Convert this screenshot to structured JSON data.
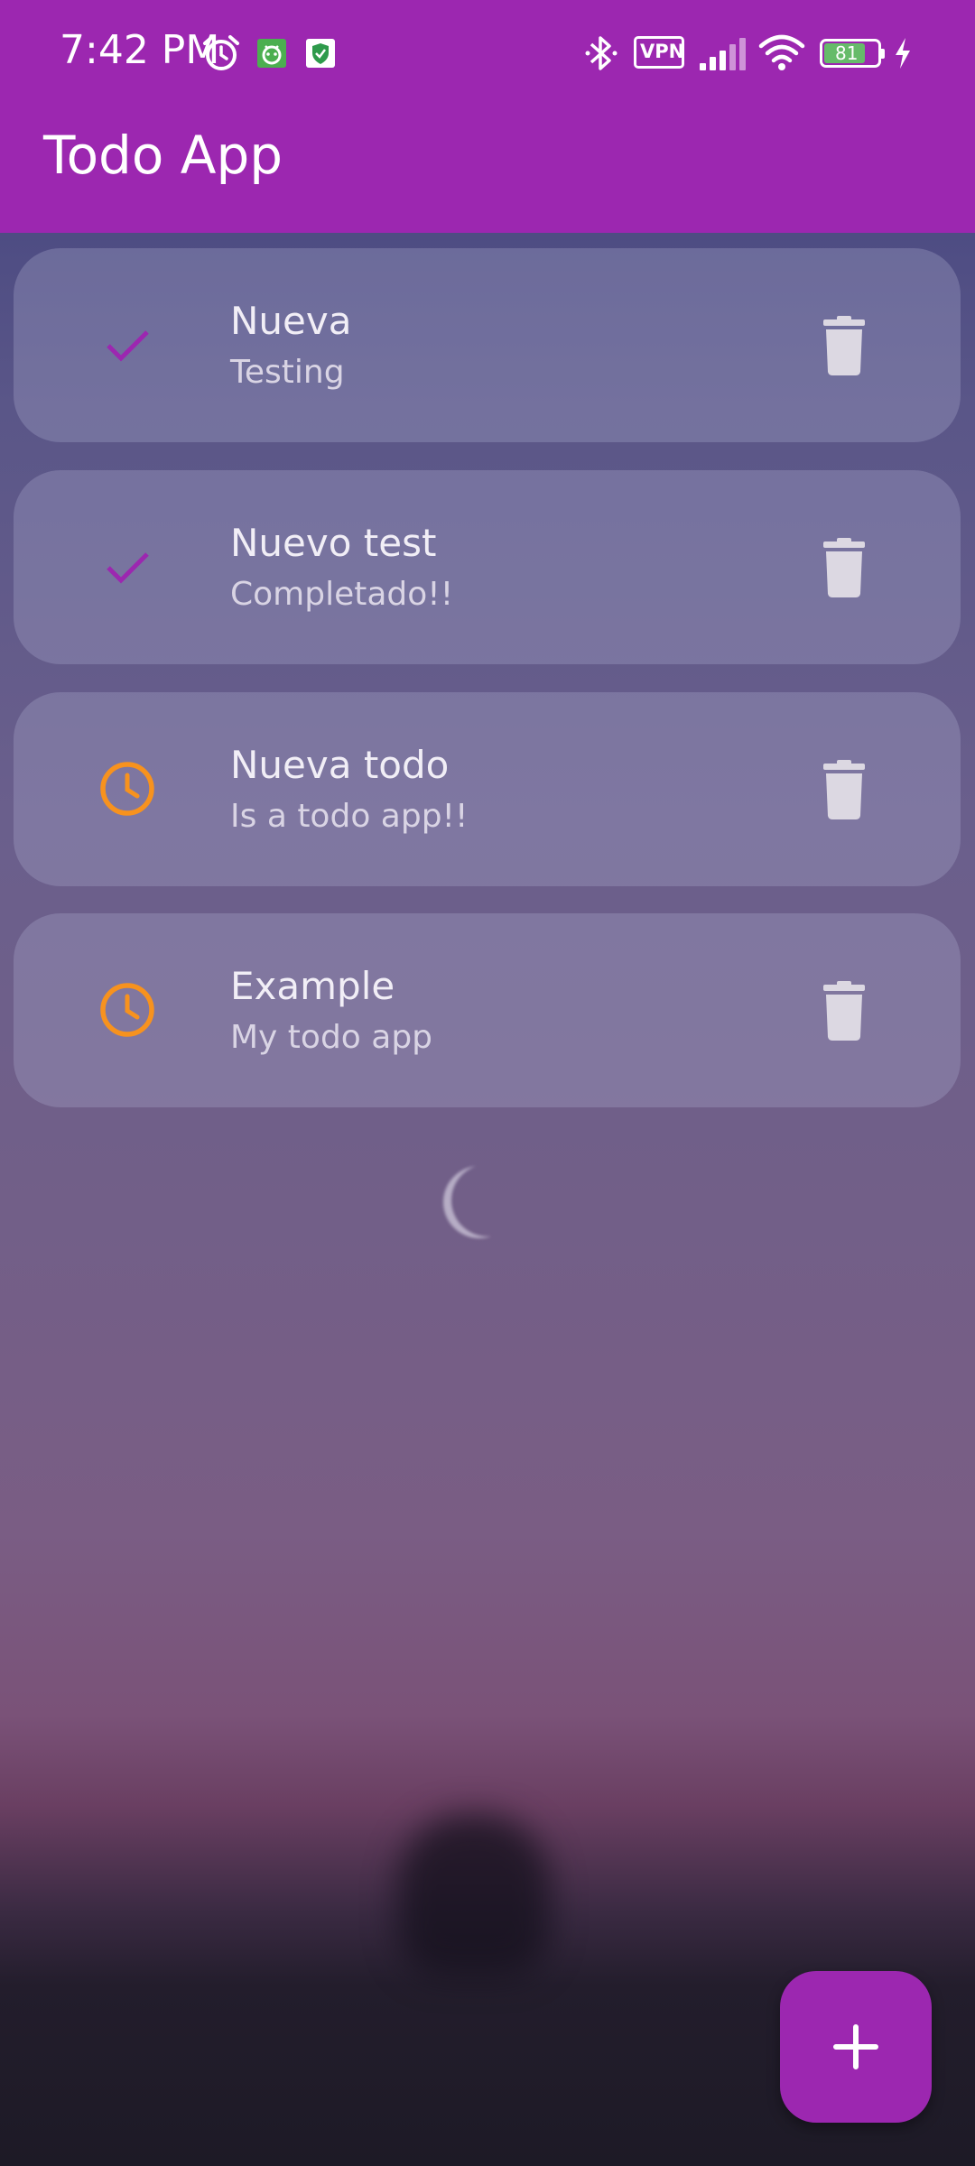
{
  "status_bar": {
    "time": "7:42 PM",
    "icons": [
      "alarm-icon",
      "app-notification-icon",
      "shield-notification-icon",
      "bluetooth-icon",
      "vpn-icon",
      "signal-icon",
      "wifi-icon",
      "battery-icon",
      "charging-icon"
    ],
    "vpn_label": "VPN",
    "battery_level": "81"
  },
  "app_bar": {
    "title": "Todo App"
  },
  "todos": [
    {
      "title": "Nueva",
      "subtitle": "Testing",
      "status": "completed",
      "status_icon": "check-icon"
    },
    {
      "title": "Nuevo test",
      "subtitle": "Completado!!",
      "status": "completed",
      "status_icon": "check-icon"
    },
    {
      "title": "Nueva todo",
      "subtitle": "Is a todo app!!",
      "status": "pending",
      "status_icon": "clock-icon"
    },
    {
      "title": "Example",
      "subtitle": "My todo app",
      "status": "pending",
      "status_icon": "clock-icon"
    }
  ],
  "fab": {
    "icon": "plus-icon"
  },
  "colors": {
    "primary": "#9c27b0",
    "completed_check": "#9c27b0",
    "pending_clock": "#f7921e",
    "delete_icon": "#dcd8e2"
  }
}
